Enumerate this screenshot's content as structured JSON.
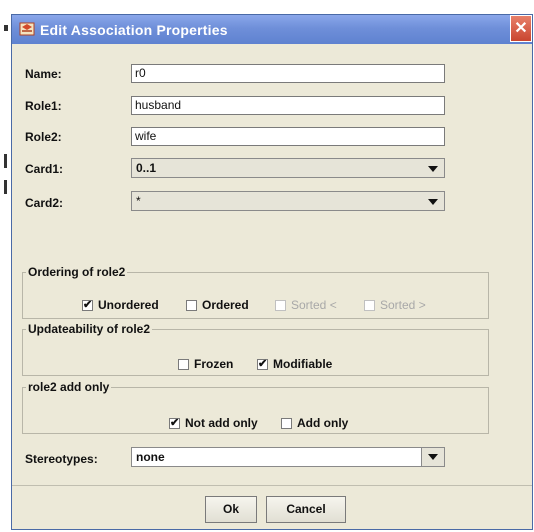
{
  "window": {
    "title": "Edit Association Properties",
    "close_glyph": "✕"
  },
  "fields": {
    "name": {
      "label": "Name:",
      "value": "r0"
    },
    "role1": {
      "label": "Role1:",
      "value": "husband"
    },
    "role2": {
      "label": "Role2:",
      "value": "wife"
    },
    "card1": {
      "label": "Card1:",
      "value": "0..1"
    },
    "card2": {
      "label": "Card2:",
      "value": "*"
    }
  },
  "ordering": {
    "title": "Ordering of role2",
    "options": [
      {
        "label": "Unordered",
        "checked": true,
        "enabled": true
      },
      {
        "label": "Ordered",
        "checked": false,
        "enabled": true
      },
      {
        "label": "Sorted <",
        "checked": false,
        "enabled": false
      },
      {
        "label": "Sorted >",
        "checked": false,
        "enabled": false
      }
    ]
  },
  "updateability": {
    "title": "Updateability of role2",
    "options": [
      {
        "label": "Frozen",
        "checked": false,
        "enabled": true
      },
      {
        "label": "Modifiable",
        "checked": true,
        "enabled": true
      }
    ]
  },
  "add_only": {
    "title": "role2 add only",
    "options": [
      {
        "label": "Not add only",
        "checked": true,
        "enabled": true
      },
      {
        "label": "Add only",
        "checked": false,
        "enabled": true
      }
    ]
  },
  "stereotypes": {
    "label": "Stereotypes:",
    "value": "none"
  },
  "buttons": {
    "ok": "Ok",
    "cancel": "Cancel"
  },
  "colors": {
    "titlebar": "#6f8fd9",
    "dialog_bg": "#ece9d8",
    "close": "#c9452f"
  }
}
